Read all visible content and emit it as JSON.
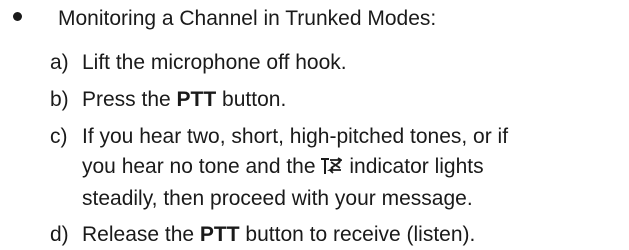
{
  "heading": "Monitoring a Channel in Trunked Modes:",
  "steps": {
    "a": {
      "marker": "a)",
      "text": "Lift the microphone off hook."
    },
    "b": {
      "marker": "b)",
      "pre": "Press the ",
      "bold": "PTT",
      "post": " button."
    },
    "c": {
      "marker": "c)",
      "line1": "If you hear two, short, high-pitched tones, or if",
      "line2_pre": "you hear no tone and the",
      "line2_post": " indicator lights",
      "line3": "steadily, then proceed with your message."
    },
    "d": {
      "marker": "d)",
      "pre": "Release the ",
      "bold": "PTT",
      "post": " button to receive (listen)."
    }
  },
  "icons": {
    "trunking_indicator": "trunking-signal-icon"
  },
  "colors": {
    "text": "#1a1a1a",
    "background": "#ffffff"
  }
}
